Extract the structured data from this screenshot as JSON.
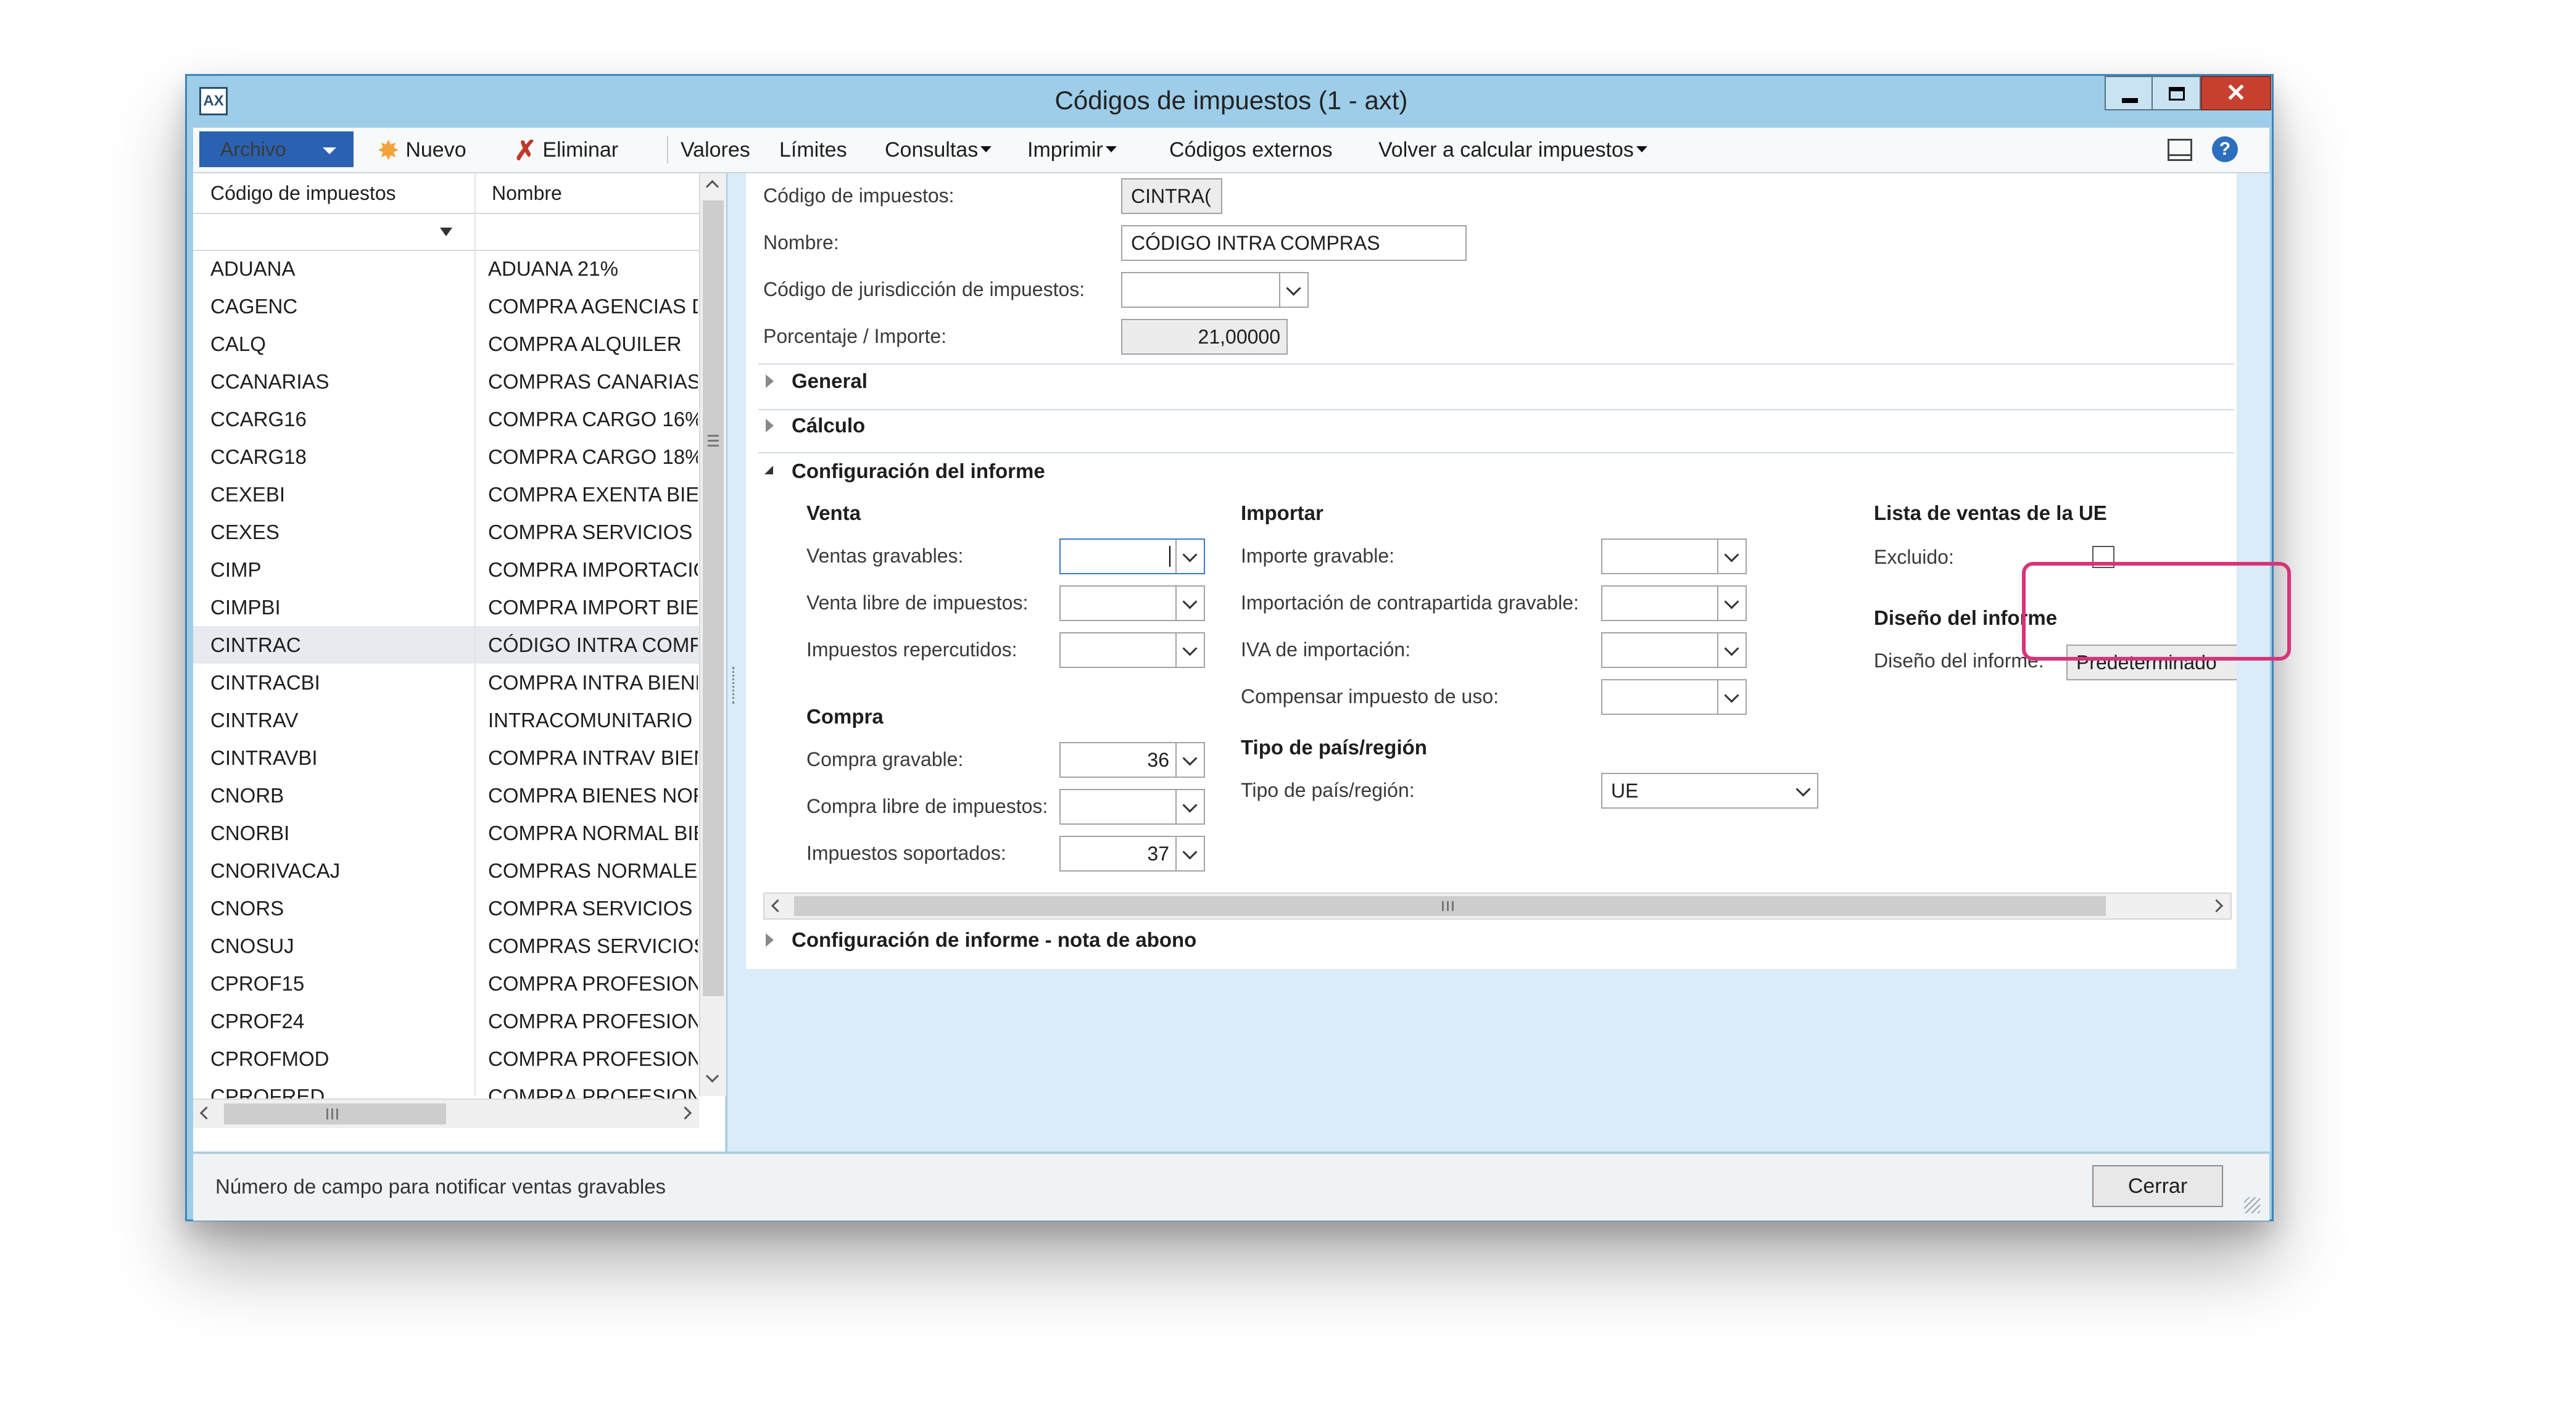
{
  "window": {
    "title": "Códigos de impuestos (1 - axt)"
  },
  "toolbar": {
    "file": "Archivo",
    "new": "Nuevo",
    "delete": "Eliminar",
    "values": "Valores",
    "limits": "Límites",
    "queries": "Consultas",
    "print": "Imprimir",
    "external_codes": "Códigos externos",
    "recalc": "Volver a calcular impuestos"
  },
  "list": {
    "col_code": "Código de impuestos",
    "col_name": "Nombre",
    "selected_index": 10,
    "rows": [
      {
        "code": "ADUANA",
        "name": "ADUANA 21%"
      },
      {
        "code": "CAGENC",
        "name": "COMPRA AGENCIAS D"
      },
      {
        "code": "CALQ",
        "name": "COMPRA ALQUILER"
      },
      {
        "code": "CCANARIAS",
        "name": "COMPRAS CANARIAS"
      },
      {
        "code": "CCARG16",
        "name": "COMPRA CARGO 16%"
      },
      {
        "code": "CCARG18",
        "name": "COMPRA CARGO 18%"
      },
      {
        "code": "CEXEBI",
        "name": "COMPRA EXENTA BIEN"
      },
      {
        "code": "CEXES",
        "name": "COMPRA SERVICIOS E"
      },
      {
        "code": "CIMP",
        "name": "COMPRA IMPORTACIO"
      },
      {
        "code": "CIMPBI",
        "name": "COMPRA IMPORT BIEN"
      },
      {
        "code": "CINTRAC",
        "name": "CÓDIGO INTRA COMP"
      },
      {
        "code": "CINTRACBI",
        "name": "COMPRA INTRA BIENE"
      },
      {
        "code": "CINTRAV",
        "name": "INTRACOMUNITARIO"
      },
      {
        "code": "CINTRAVBI",
        "name": "COMPRA INTRAV BIEN"
      },
      {
        "code": "CNORB",
        "name": "COMPRA  BIENES NOR"
      },
      {
        "code": "CNORBI",
        "name": "COMPRA NORMAL BIE"
      },
      {
        "code": "CNORIVACAJ",
        "name": "COMPRAS NORMALES"
      },
      {
        "code": "CNORS",
        "name": "COMPRA SERVICIOS N"
      },
      {
        "code": "CNOSUJ",
        "name": "COMPRAS SERVICIOS I"
      },
      {
        "code": "CPROF15",
        "name": "COMPRA PROFESIONA"
      },
      {
        "code": "CPROF24",
        "name": "COMPRA PROFESIONA"
      },
      {
        "code": "CPROFMOD",
        "name": "COMPRA PROFESIONA"
      },
      {
        "code": "CPROFRED",
        "name": "COMPRA PROFESIONA"
      }
    ]
  },
  "detail": {
    "code_label": "Código de impuestos:",
    "code_value": "CINTRA(",
    "name_label": "Nombre:",
    "name_value": "CÓDIGO INTRA COMPRAS",
    "jurisdiction_label": "Código de jurisdicción de impuestos:",
    "jurisdiction_value": "",
    "pct_label": "Porcentaje / Importe:",
    "pct_value": "21,00000",
    "sections": {
      "general": "General",
      "calc": "Cálculo",
      "report": "Configuración del informe",
      "credit": "Configuración de informe - nota de abono"
    },
    "venta": {
      "title": "Venta",
      "taxable": "Ventas gravables:",
      "taxable_value": "",
      "free": "Venta libre de impuestos:",
      "free_value": "",
      "charged": "Impuestos repercutidos:",
      "charged_value": ""
    },
    "compra": {
      "title": "Compra",
      "taxable": "Compra gravable:",
      "taxable_value": "36",
      "free": "Compra libre de impuestos:",
      "free_value": "",
      "paid": "Impuestos soportados:",
      "paid_value": "37"
    },
    "importar": {
      "title": "Importar",
      "taxable": "Importe gravable:",
      "offset": "Importación de contrapartida gravable:",
      "vat": "IVA de importación:",
      "use_tax": "Compensar impuesto de uso:"
    },
    "country": {
      "title": "Tipo de país/región",
      "label": "Tipo de país/región:",
      "value": "UE"
    },
    "eu_list": {
      "title": "Lista de ventas de la UE",
      "excluded": "Excluido:",
      "excluded_checked": false
    },
    "design": {
      "title": "Diseño del informe",
      "label": "Diseño del informe:",
      "value": "Predeterminado"
    }
  },
  "status": {
    "text": "Número de campo para notificar ventas gravables",
    "close": "Cerrar"
  },
  "colors": {
    "frame": "#9dcde8",
    "accent": "#2a62b1",
    "highlight": "#d8347a"
  }
}
